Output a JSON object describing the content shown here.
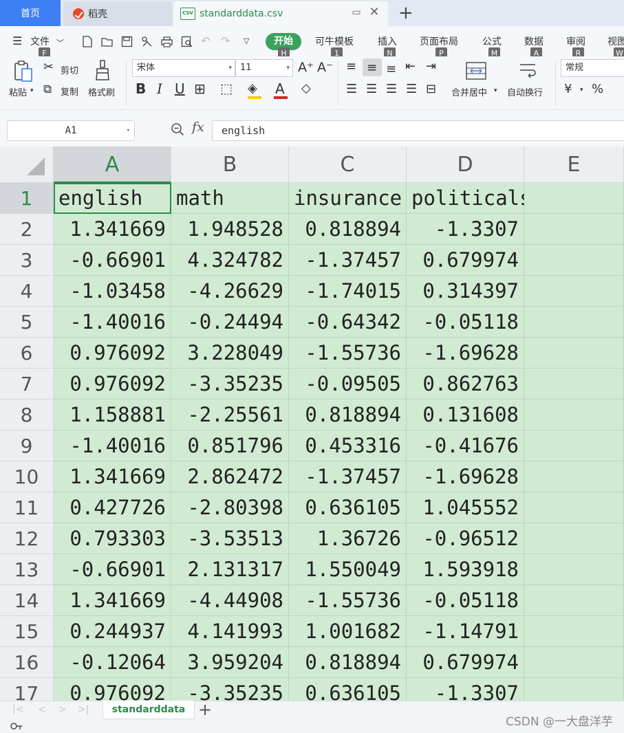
{
  "tabs": {
    "home": "首页",
    "wps": "稻壳",
    "file": "standarddata.csv",
    "file_icon": "CSV"
  },
  "menu": {
    "file": "文件",
    "items": [
      {
        "label": "开始",
        "key": "H"
      },
      {
        "label": "可牛模板",
        "key": "1"
      },
      {
        "label": "插入",
        "key": "N"
      },
      {
        "label": "页面布局",
        "key": "P"
      },
      {
        "label": "公式",
        "key": "M"
      },
      {
        "label": "数据",
        "key": "A"
      },
      {
        "label": "审阅",
        "key": "R"
      },
      {
        "label": "视图",
        "key": "W"
      }
    ],
    "file_key": "F"
  },
  "ribbon": {
    "paste": "粘贴",
    "cut": "剪切",
    "copy": "复制",
    "format_painter": "格式刷",
    "font_name": "宋体",
    "font_size": "11",
    "merge_center": "合并居中",
    "wrap_text": "自动换行",
    "number_format": "常规",
    "currency": "¥",
    "percent": "%",
    "bold": "B",
    "italic": "I",
    "underline": "U",
    "font_color": "A"
  },
  "formula": {
    "cell_ref": "A1",
    "fx": "fx",
    "value": "english"
  },
  "grid": {
    "columns": [
      "A",
      "B",
      "C",
      "D",
      "E"
    ],
    "row_numbers": [
      "1",
      "2",
      "3",
      "4",
      "5",
      "6",
      "7",
      "8",
      "9",
      "10",
      "11",
      "12",
      "13",
      "14",
      "15",
      "16",
      "17"
    ],
    "headers": [
      "english",
      "math",
      "insurance",
      "politicals"
    ],
    "rows": [
      [
        "1.341669",
        "1.948528",
        "0.818894",
        "-1.3307"
      ],
      [
        "-0.66901",
        "4.324782",
        "-1.37457",
        "0.679974"
      ],
      [
        "-1.03458",
        "-4.26629",
        "-1.74015",
        "0.314397"
      ],
      [
        "-1.40016",
        "-0.24494",
        "-0.64342",
        "-0.05118"
      ],
      [
        "0.976092",
        "3.228049",
        "-1.55736",
        "-1.69628"
      ],
      [
        "0.976092",
        "-3.35235",
        "-0.09505",
        "0.862763"
      ],
      [
        "1.158881",
        "-2.25561",
        "0.818894",
        "0.131608"
      ],
      [
        "-1.40016",
        "0.851796",
        "0.453316",
        "-0.41676"
      ],
      [
        "1.341669",
        "2.862472",
        "-1.37457",
        "-1.69628"
      ],
      [
        "0.427726",
        "-2.80398",
        "0.636105",
        "1.045552"
      ],
      [
        "0.793303",
        "-3.53513",
        "1.36726",
        "-0.96512"
      ],
      [
        "-0.66901",
        "2.131317",
        "1.550049",
        "1.593918"
      ],
      [
        "1.341669",
        "-4.44908",
        "-1.55736",
        "-0.05118"
      ],
      [
        "0.244937",
        "4.141993",
        "1.001682",
        "-1.14791"
      ],
      [
        "-0.12064",
        "3.959204",
        "0.818894",
        "0.679974"
      ],
      [
        "0.976092",
        "-3.35235",
        "0.636105",
        "-1.3307"
      ]
    ]
  },
  "sheets": {
    "active": "standarddata",
    "add": "+"
  },
  "watermark": "CSDN @一大盘洋芋",
  "colors": {
    "accent": "#2b8a4b",
    "cell_fill": "#d1ebd3",
    "home_tab": "#3d7ff5"
  }
}
